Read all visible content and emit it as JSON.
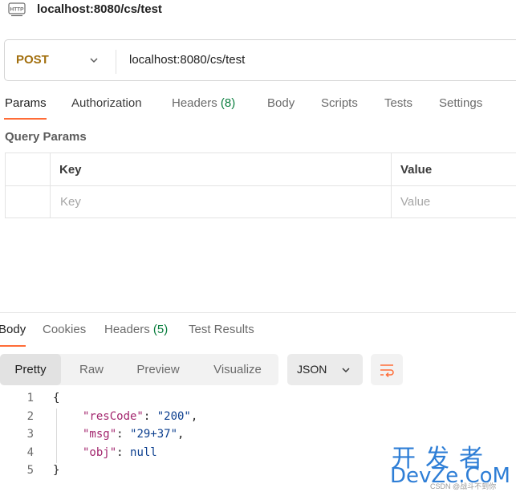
{
  "header": {
    "title": "localhost:8080/cs/test",
    "icon": "http-icon",
    "icon_text": "HTTP"
  },
  "request": {
    "method": "POST",
    "method_color": "#a26f0e",
    "url": "localhost:8080/cs/test"
  },
  "request_tabs": {
    "params": "Params",
    "authorization": "Authorization",
    "headers": "Headers",
    "headers_count": "(8)",
    "body": "Body",
    "scripts": "Scripts",
    "tests": "Tests",
    "settings": "Settings",
    "active": "Params",
    "accent": "#ff6c37"
  },
  "query_params": {
    "title": "Query Params",
    "columns": [
      "Key",
      "Value"
    ],
    "placeholder_key": "Key",
    "placeholder_value": "Value"
  },
  "response_tabs": {
    "body": "Body",
    "cookies": "Cookies",
    "headers": "Headers",
    "headers_count": "(5)",
    "test_results": "Test Results",
    "active": "Body"
  },
  "view_modes": {
    "pretty": "Pretty",
    "raw": "Raw",
    "preview": "Preview",
    "visualize": "Visualize",
    "active": "Pretty"
  },
  "format": {
    "selected": "JSON"
  },
  "response_body": {
    "line_numbers": [
      "1",
      "2",
      "3",
      "4",
      "5"
    ],
    "open_brace": "{",
    "close_brace": "}",
    "entries": [
      {
        "key": "\"resCode\"",
        "value": "\"200\"",
        "trail": ","
      },
      {
        "key": "\"msg\"",
        "value": "\"29+37\"",
        "trail": ","
      },
      {
        "key": "\"obj\"",
        "value": "null",
        "trail": ""
      }
    ]
  },
  "watermark": {
    "cn": "开发者",
    "en": "DevZe.CoM",
    "small": "CSDN @战斗不到你"
  }
}
